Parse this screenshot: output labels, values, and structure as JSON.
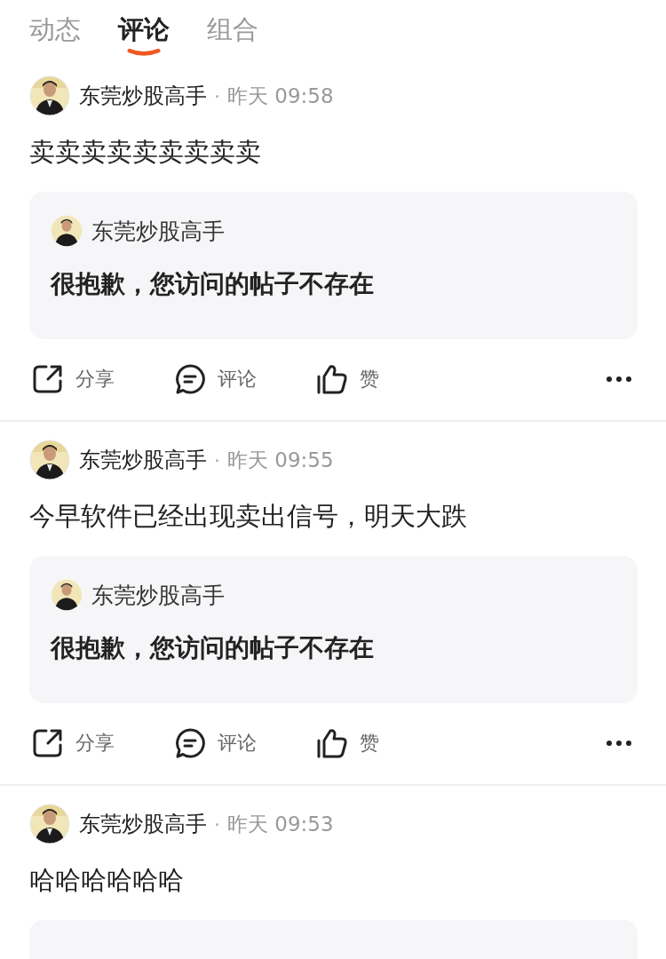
{
  "tabs": [
    {
      "label": "动态",
      "selected": false
    },
    {
      "label": "评论",
      "selected": true
    },
    {
      "label": "组合",
      "selected": false
    }
  ],
  "posts": [
    {
      "author": "东莞炒股高手",
      "separator": "·",
      "time": "昨天 09:58",
      "content": "卖卖卖卖卖卖卖卖卖",
      "quote_card": true,
      "quote": {
        "author": "东莞炒股高手",
        "text": "很抱歉，您访问的帖子不存在"
      },
      "actions": [
        {
          "kind": "share",
          "label": "分享"
        },
        {
          "kind": "comment",
          "label": "评论"
        },
        {
          "kind": "like",
          "label": "赞"
        }
      ]
    },
    {
      "author": "东莞炒股高手",
      "separator": "·",
      "time": "昨天 09:55",
      "content": "今早软件已经出现卖出信号，明天大跌",
      "quote_card": true,
      "quote": {
        "author": "东莞炒股高手",
        "text": "很抱歉，您访问的帖子不存在"
      },
      "actions": [
        {
          "kind": "share",
          "label": "分享"
        },
        {
          "kind": "comment",
          "label": "评论"
        },
        {
          "kind": "like",
          "label": "赞"
        }
      ]
    },
    {
      "author": "东莞炒股高手",
      "separator": "·",
      "time": "昨天 09:53",
      "content": "哈哈哈哈哈哈",
      "quote_card": true
    }
  ]
}
